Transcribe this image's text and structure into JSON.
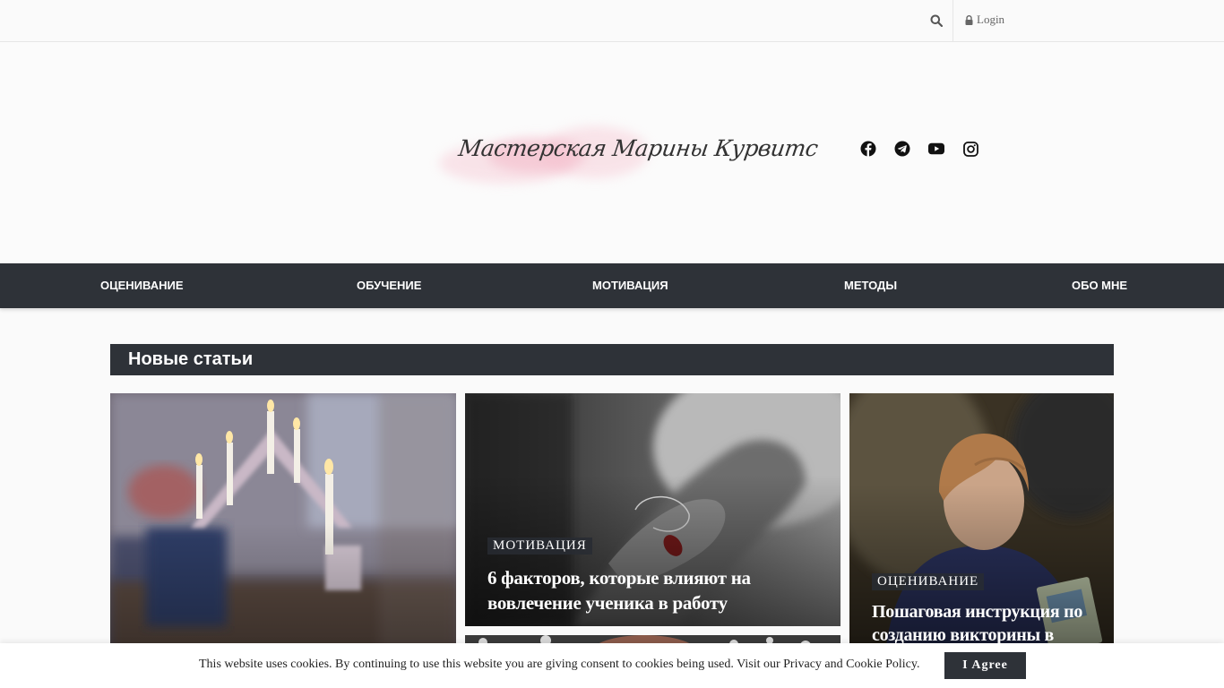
{
  "topbar": {
    "search_icon": "search-icon",
    "login_icon": "lock-icon",
    "login_label": "Login"
  },
  "header": {
    "logo_text": "Мастерская Марины Курвитс",
    "socials": [
      "facebook-icon",
      "telegram-icon",
      "youtube-icon",
      "instagram-icon"
    ]
  },
  "nav": {
    "items": [
      {
        "label": "ОЦЕНИВАНИЕ"
      },
      {
        "label": "ОБУЧЕНИЕ"
      },
      {
        "label": "МОТИВАЦИЯ"
      },
      {
        "label": "МЕТОДЫ"
      },
      {
        "label": "ОБО МНЕ"
      }
    ]
  },
  "section": {
    "title": "Новые статьи"
  },
  "articles": [
    {
      "category": "",
      "title": ""
    },
    {
      "category": "МОТИВАЦИЯ",
      "title": "6 факторов, которые влияют на вовлечение ученика в работу"
    },
    {
      "category": "ОЦЕНИВАНИЕ",
      "title": "Пошаговая инструкция по созданию викторины в"
    }
  ],
  "cookie": {
    "text": "This website uses cookies. By continuing to use this website you are giving consent to cookies being used. Visit our Privacy and Cookie Policy.",
    "button": "I Agree"
  },
  "colors": {
    "dark": "#2e3238",
    "background": "#fafafa"
  }
}
